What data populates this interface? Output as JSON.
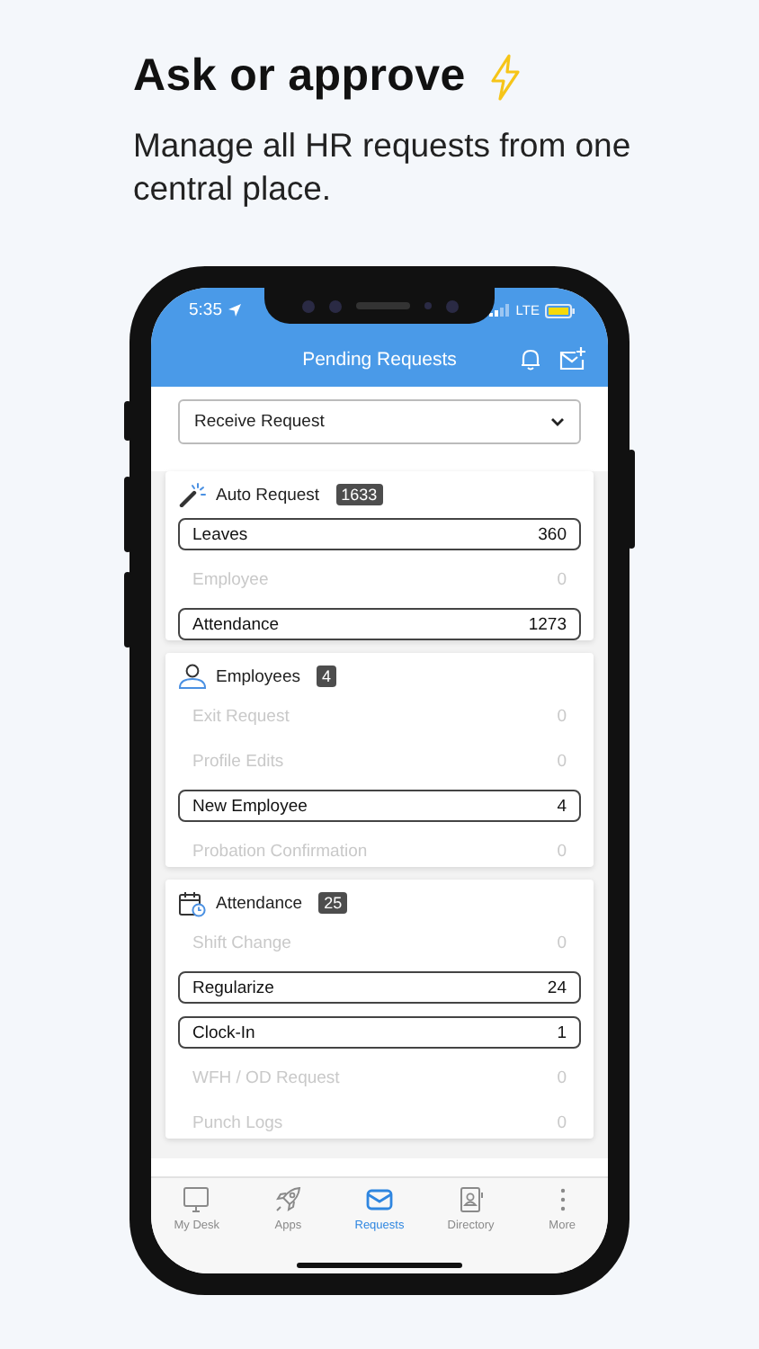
{
  "headline": {
    "title": "Ask or approve",
    "subtitle": "Manage all HR requests from one central place."
  },
  "status_bar": {
    "time": "5:35",
    "network": "LTE"
  },
  "header": {
    "title": "Pending Requests"
  },
  "dropdown": {
    "value": "Receive Request"
  },
  "sections": [
    {
      "title": "Auto Request",
      "count": "1633",
      "items": [
        {
          "label": "Leaves",
          "value": "360",
          "enabled": true
        },
        {
          "label": "Employee",
          "value": "0",
          "enabled": false
        },
        {
          "label": "Attendance",
          "value": "1273",
          "enabled": true
        }
      ]
    },
    {
      "title": "Employees",
      "count": "4",
      "items": [
        {
          "label": "Exit Request",
          "value": "0",
          "enabled": false
        },
        {
          "label": "Profile Edits",
          "value": "0",
          "enabled": false
        },
        {
          "label": "New Employee",
          "value": "4",
          "enabled": true
        },
        {
          "label": "Probation Confirmation",
          "value": "0",
          "enabled": false
        }
      ]
    },
    {
      "title": "Attendance",
      "count": "25",
      "items": [
        {
          "label": "Shift Change",
          "value": "0",
          "enabled": false
        },
        {
          "label": "Regularize",
          "value": "24",
          "enabled": true
        },
        {
          "label": "Clock-In",
          "value": "1",
          "enabled": true
        },
        {
          "label": "WFH / OD Request",
          "value": "0",
          "enabled": false
        },
        {
          "label": "Punch Logs",
          "value": "0",
          "enabled": false
        }
      ]
    }
  ],
  "tabs": [
    {
      "label": "My Desk",
      "selected": false
    },
    {
      "label": "Apps",
      "selected": false
    },
    {
      "label": "Requests",
      "selected": true
    },
    {
      "label": "Directory",
      "selected": false
    },
    {
      "label": "More",
      "selected": false
    }
  ]
}
